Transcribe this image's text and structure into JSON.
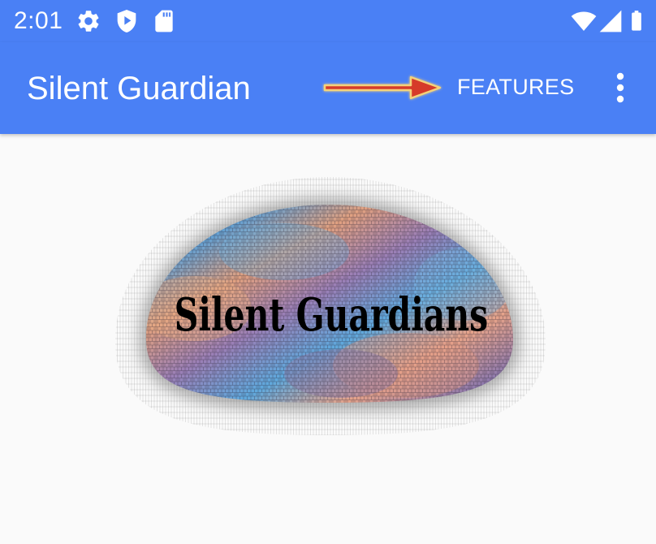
{
  "status_bar": {
    "time": "2:01",
    "icons_left": [
      "gear-icon",
      "play-shield-icon",
      "sd-card-icon"
    ],
    "icons_right": [
      "wifi-icon",
      "cell-signal-icon",
      "battery-icon"
    ]
  },
  "app_bar": {
    "title": "Silent Guardian",
    "action_label": "FEATURES",
    "overflow_icon": "more-vert-icon",
    "annotation_icon": "red-arrow-icon"
  },
  "main": {
    "logo_text": "Silent Guardians"
  },
  "colors": {
    "primary": "#4a80f5",
    "on_primary": "#ffffff",
    "background": "#fafafa",
    "arrow": "#d63a2a"
  }
}
